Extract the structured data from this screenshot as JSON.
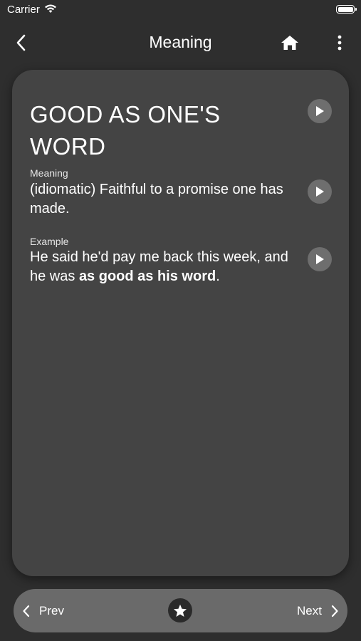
{
  "status_bar": {
    "carrier": "Carrier"
  },
  "nav": {
    "title": "Meaning",
    "back_icon": "chevron-left-icon",
    "home_icon": "home-icon",
    "more_icon": "more-vertical-icon"
  },
  "card": {
    "word": "GOOD AS ONE'S WORD",
    "meaning_label": "Meaning",
    "meaning_text": "(idiomatic) Faithful to a promise one has made.",
    "example_label": "Example",
    "example_text_before": "He said he'd pay me back this week, and he was ",
    "example_text_bold": "as good as his word",
    "example_text_after": "."
  },
  "bottom_bar": {
    "prev_label": "Prev",
    "next_label": "Next",
    "favorite_icon": "star-icon"
  },
  "colors": {
    "background": "#2e2e2e",
    "card": "#444444",
    "bottom_bar": "#6a6a6a",
    "play_button": "#6e6e6e"
  }
}
